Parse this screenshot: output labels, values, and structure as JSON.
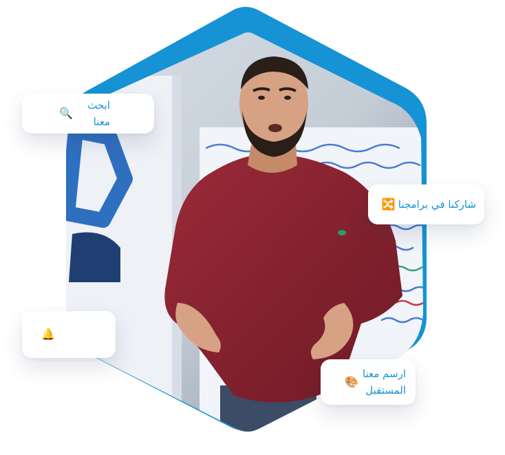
{
  "colors": {
    "accent_blue": "#1593d4",
    "shirt_red": "#8c2330"
  },
  "chips": {
    "search": {
      "label": "ابحث معنا",
      "icon": "magnifier-icon",
      "emoji": "🔍"
    },
    "share": {
      "label": "شاركنا في برامجنا",
      "icon": "shuffle-icon",
      "emoji": "🔀"
    },
    "bell": {
      "label": "",
      "icon": "bell-icon",
      "emoji": "🔔"
    },
    "draw": {
      "label": "ارسم معنا\nالمستقبل",
      "icon": "palette-icon",
      "emoji": "🎨"
    }
  }
}
